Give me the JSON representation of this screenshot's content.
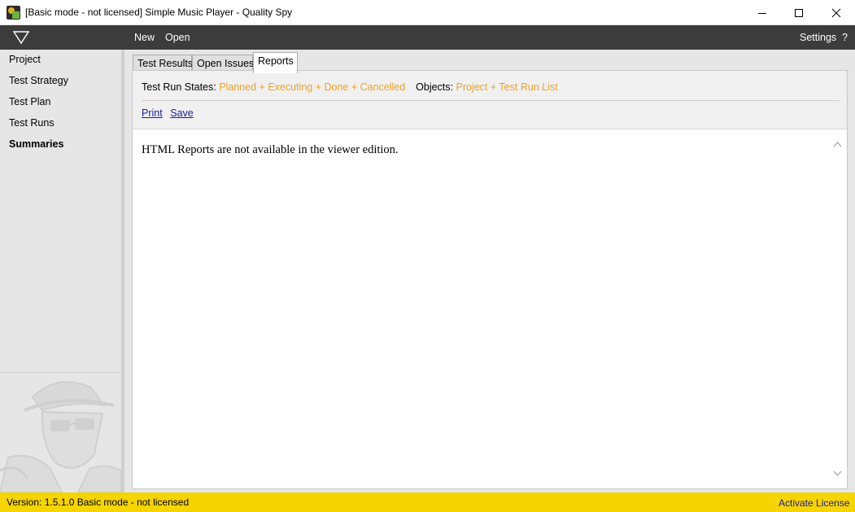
{
  "window": {
    "title": "[Basic mode - not licensed] Simple Music Player - Quality Spy",
    "app_icon": "quality-spy-app-icon",
    "controls": [
      "minimize-icon",
      "maximize-icon",
      "close-icon"
    ]
  },
  "toolbar": {
    "logo": "triangle-logo-icon",
    "new_label": "New",
    "open_label": "Open",
    "settings_label": "Settings",
    "help_label": "?"
  },
  "sidebar": {
    "items": [
      {
        "label": "Project",
        "active": false
      },
      {
        "label": "Test Strategy",
        "active": false
      },
      {
        "label": "Test Plan",
        "active": false
      },
      {
        "label": "Test Runs",
        "active": false
      },
      {
        "label": "Summaries",
        "active": true
      }
    ],
    "mascot": "spy-mascot-icon"
  },
  "tabs": [
    {
      "label": "Test Results",
      "active": false
    },
    {
      "label": "Open Issues",
      "active": false
    },
    {
      "label": "Reports",
      "active": true
    }
  ],
  "reports": {
    "states_label": "Test Run States:",
    "states_value": "Planned + Executing + Done + Cancelled",
    "objects_label": "Objects:",
    "objects_value": "Project + Test Run List",
    "print_label": "Print",
    "save_label": "Save",
    "message": "HTML Reports are not available in the viewer edition."
  },
  "statusbar": {
    "text": "Version: 1.5.1.0  Basic mode - not licensed",
    "activate_label": "Activate License"
  },
  "colors": {
    "toolbar_bg": "#3c3c3c",
    "sidebar_bg": "#e6e6e6",
    "filter_value": "#f0a020",
    "link": "#1a1aa6",
    "statusbar_bg": "#f5d400"
  }
}
